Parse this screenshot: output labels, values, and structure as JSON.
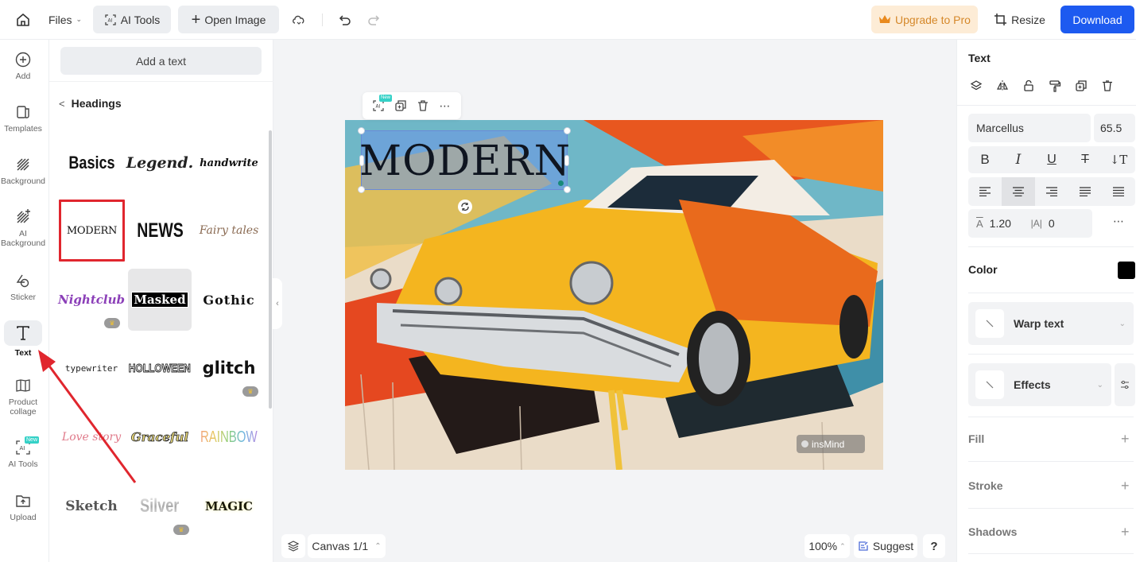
{
  "topbar": {
    "home_icon": "home-icon",
    "files_label": "Files",
    "ai_tools_label": "AI Tools",
    "open_image_label": "Open Image",
    "cloud_icon": "cloud-sync-icon",
    "undo_icon": "undo-icon",
    "redo_icon": "redo-icon",
    "upgrade_label": "Upgrade to Pro",
    "resize_label": "Resize",
    "download_label": "Download",
    "colors": {
      "upgrade_bg": "#fdecd6",
      "upgrade_text": "#d5882a",
      "download_bg": "#1d5af0"
    }
  },
  "leftnav": {
    "items": [
      {
        "label": "Add",
        "icon": "plus-circle-icon"
      },
      {
        "label": "Templates",
        "icon": "templates-icon"
      },
      {
        "label": "Background",
        "icon": "background-icon"
      },
      {
        "label": "AI Background",
        "icon": "ai-background-icon"
      },
      {
        "label": "Sticker",
        "icon": "sticker-icon"
      },
      {
        "label": "Text",
        "icon": "text-icon",
        "active": true
      },
      {
        "label": "Product collage",
        "icon": "collage-icon"
      },
      {
        "label": "AI Tools",
        "icon": "ai-tools-icon",
        "badge": "New"
      },
      {
        "label": "Upload",
        "icon": "upload-icon"
      }
    ]
  },
  "panel": {
    "add_text_label": "Add a text",
    "section_label": "Headings",
    "styles": [
      {
        "label": "Basics"
      },
      {
        "label": "Legend."
      },
      {
        "label": "handwrite"
      },
      {
        "label": "MODERN",
        "selected": true
      },
      {
        "label": "NEWS"
      },
      {
        "label": "Fairy tales"
      },
      {
        "label": "Nightclub",
        "premium": true
      },
      {
        "label": "Masked",
        "hover": true
      },
      {
        "label": "Gothic"
      },
      {
        "label": "typewriter"
      },
      {
        "label": "HOLLOWEEN"
      },
      {
        "label": "glitch",
        "premium": true
      },
      {
        "label": "Love story"
      },
      {
        "label": "Graceful"
      },
      {
        "label": "RAINBOW"
      },
      {
        "label": "Sketch"
      },
      {
        "label": "Silver",
        "premium": true
      },
      {
        "label": "MAGIC"
      }
    ]
  },
  "canvas": {
    "float_toolbar": {
      "ai_badge": "New",
      "icons": [
        "ai-icon",
        "duplicate-icon",
        "delete-icon",
        "more-icon"
      ]
    },
    "selected_text": "MODERN",
    "watermark": "insMind",
    "canvas_label": "Canvas 1/1",
    "zoom": "100%",
    "suggest_label": "Suggest",
    "help_label": "?"
  },
  "props": {
    "title": "Text",
    "font_family": "Marcellus",
    "font_size": "65.5",
    "line_height": "1.20",
    "letter_spacing": "0",
    "align_active": "center",
    "color_label": "Color",
    "color_value": "#000000",
    "warp_label": "Warp text",
    "effects_label": "Effects",
    "fill_label": "Fill",
    "stroke_label": "Stroke",
    "shadows_label": "Shadows"
  }
}
